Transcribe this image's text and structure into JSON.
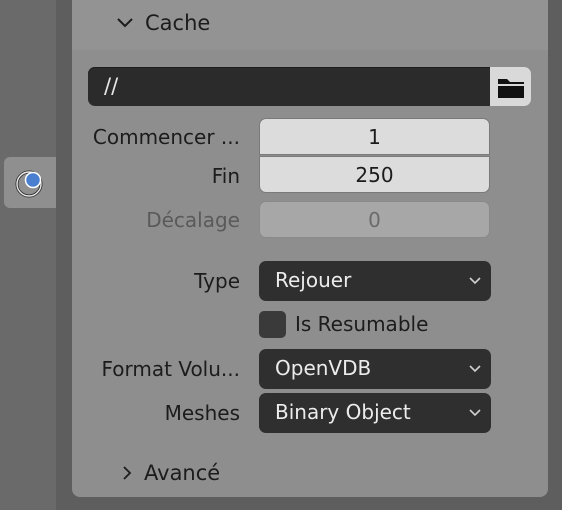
{
  "sidebar": {
    "active_tab_icon": "physics-cache-icon"
  },
  "panel": {
    "title": "Cache",
    "path_value": "//",
    "folder_icon": "folder-icon",
    "fields": {
      "start_label": "Commencer ...",
      "start_value": "1",
      "end_label": "Fin",
      "end_value": "250",
      "offset_label": "Décalage",
      "offset_value": "0"
    },
    "type_label": "Type",
    "type_value": "Rejouer",
    "resumable_label": "Is Resumable",
    "resumable_checked": false,
    "format_label": "Format Volu...",
    "format_value": "OpenVDB",
    "meshes_label": "Meshes",
    "meshes_value": "Binary Object",
    "advanced_label": "Avancé"
  },
  "colors": {
    "panel_bg": "#8e8e8e",
    "dark_field": "#2f2f2f",
    "light_field": "#dcdcdc",
    "accent_icon": "#4a7fd0"
  }
}
